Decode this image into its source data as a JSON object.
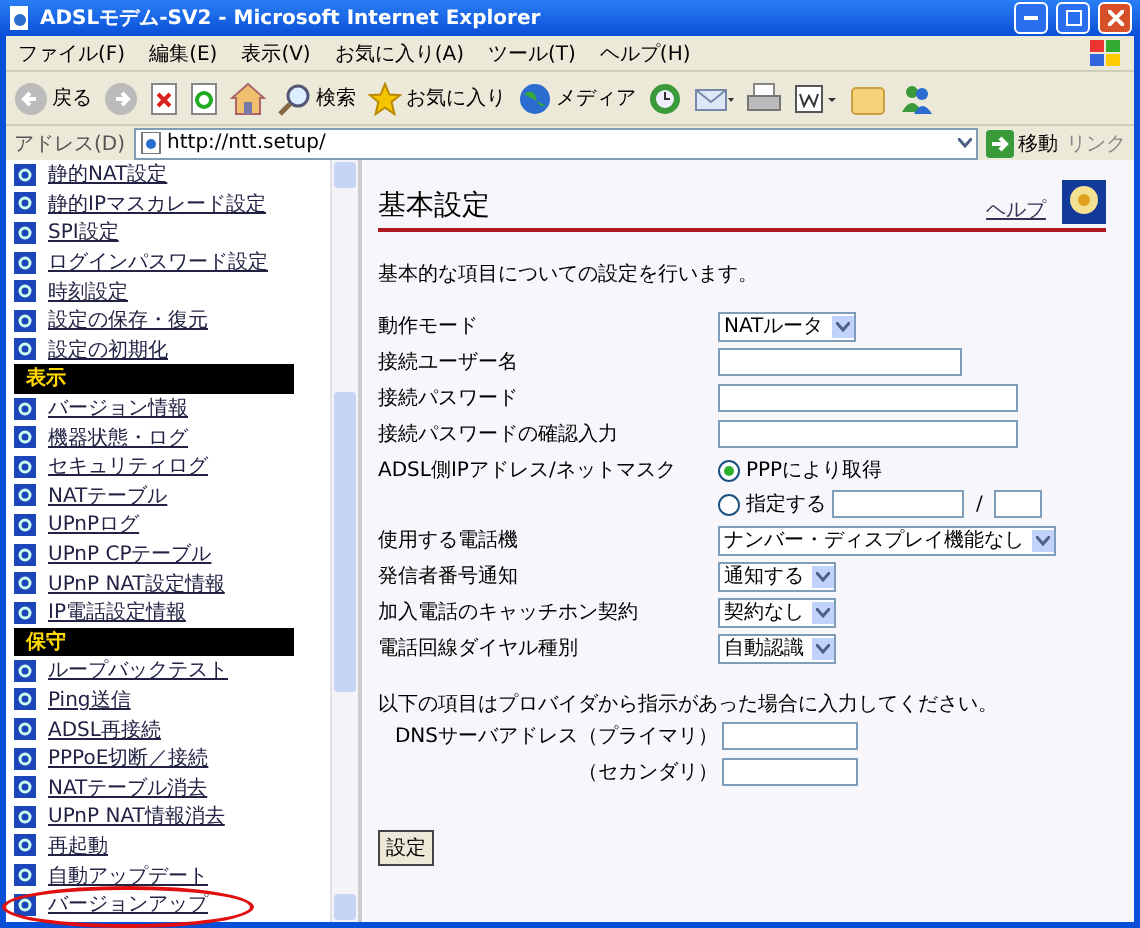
{
  "window": {
    "title": "ADSLモデム-SV2 - Microsoft Internet Explorer"
  },
  "menu": [
    "ファイル(F)",
    "編集(E)",
    "表示(V)",
    "お気に入り(A)",
    "ツール(T)",
    "ヘルプ(H)"
  ],
  "toolbar": [
    {
      "kind": "back",
      "label": "戻る"
    },
    {
      "kind": "forward"
    },
    {
      "kind": "stop"
    },
    {
      "kind": "refresh"
    },
    {
      "kind": "home"
    },
    {
      "kind": "search",
      "label": "検索"
    },
    {
      "kind": "favorites",
      "label": "お気に入り"
    },
    {
      "kind": "media",
      "label": "メディア"
    },
    {
      "kind": "history"
    },
    {
      "kind": "mail"
    },
    {
      "kind": "print"
    },
    {
      "kind": "edit"
    },
    {
      "kind": "folder"
    },
    {
      "kind": "messenger"
    }
  ],
  "address": {
    "label": "アドレス(D)",
    "url": "http://ntt.setup/",
    "go": "移動",
    "links": "リンク"
  },
  "sidebar": [
    {
      "kind": "link",
      "label": "静的NAT設定"
    },
    {
      "kind": "link",
      "label": "静的IPマスカレード設定"
    },
    {
      "kind": "link",
      "label": "SPI設定"
    },
    {
      "kind": "link",
      "label": "ログインパスワード設定"
    },
    {
      "kind": "link",
      "label": "時刻設定"
    },
    {
      "kind": "link",
      "label": "設定の保存・復元"
    },
    {
      "kind": "link",
      "label": "設定の初期化"
    },
    {
      "kind": "header",
      "label": "表示"
    },
    {
      "kind": "link",
      "label": "バージョン情報"
    },
    {
      "kind": "link",
      "label": "機器状態・ログ"
    },
    {
      "kind": "link",
      "label": "セキュリティログ"
    },
    {
      "kind": "link",
      "label": "NATテーブル"
    },
    {
      "kind": "link",
      "label": "UPnPログ"
    },
    {
      "kind": "link",
      "label": "UPnP CPテーブル"
    },
    {
      "kind": "link",
      "label": "UPnP NAT設定情報"
    },
    {
      "kind": "link",
      "label": "IP電話設定情報"
    },
    {
      "kind": "header",
      "label": "保守"
    },
    {
      "kind": "link",
      "label": "ループバックテスト"
    },
    {
      "kind": "link",
      "label": "Ping送信"
    },
    {
      "kind": "link",
      "label": "ADSL再接続"
    },
    {
      "kind": "link",
      "label": "PPPoE切断／接続"
    },
    {
      "kind": "link",
      "label": "NATテーブル消去"
    },
    {
      "kind": "link",
      "label": "UPnP NAT情報消去"
    },
    {
      "kind": "link",
      "label": "再起動"
    },
    {
      "kind": "link",
      "label": "自動アップデート"
    },
    {
      "kind": "link",
      "label": "バージョンアップ",
      "circled": true
    }
  ],
  "main": {
    "heading": "基本設定",
    "help": "ヘルプ",
    "description": "基本的な項目についての設定を行います。",
    "fields": [
      {
        "kind": "select",
        "label": "動作モード",
        "value": "NATルータ"
      },
      {
        "kind": "text",
        "label": "接続ユーザー名",
        "wide": false
      },
      {
        "kind": "text",
        "label": "接続パスワード",
        "wide": true
      },
      {
        "kind": "text",
        "label": "接続パスワードの確認入力",
        "wide": true
      },
      {
        "kind": "radio",
        "label": "ADSL側IPアドレス/ネットマスク",
        "options": [
          {
            "label": "PPPにより取得",
            "selected": true
          },
          {
            "label": "指定する",
            "selected": false
          }
        ],
        "separator": "/"
      },
      {
        "kind": "select",
        "label": "使用する電話機",
        "value": "ナンバー・ディスプレイ機能なし"
      },
      {
        "kind": "select",
        "label": "発信者番号通知",
        "value": "通知する"
      },
      {
        "kind": "select",
        "label": "加入電話のキャッチホン契約",
        "value": "契約なし"
      },
      {
        "kind": "select",
        "label": "電話回線ダイヤル種別",
        "value": "自動認識"
      }
    ],
    "note": "以下の項目はプロバイダから指示があった場合に入力してください。",
    "dns": [
      {
        "label": "DNSサーバアドレス（プライマリ）"
      },
      {
        "label": "（セカンダリ）"
      }
    ],
    "submit": "設定"
  }
}
